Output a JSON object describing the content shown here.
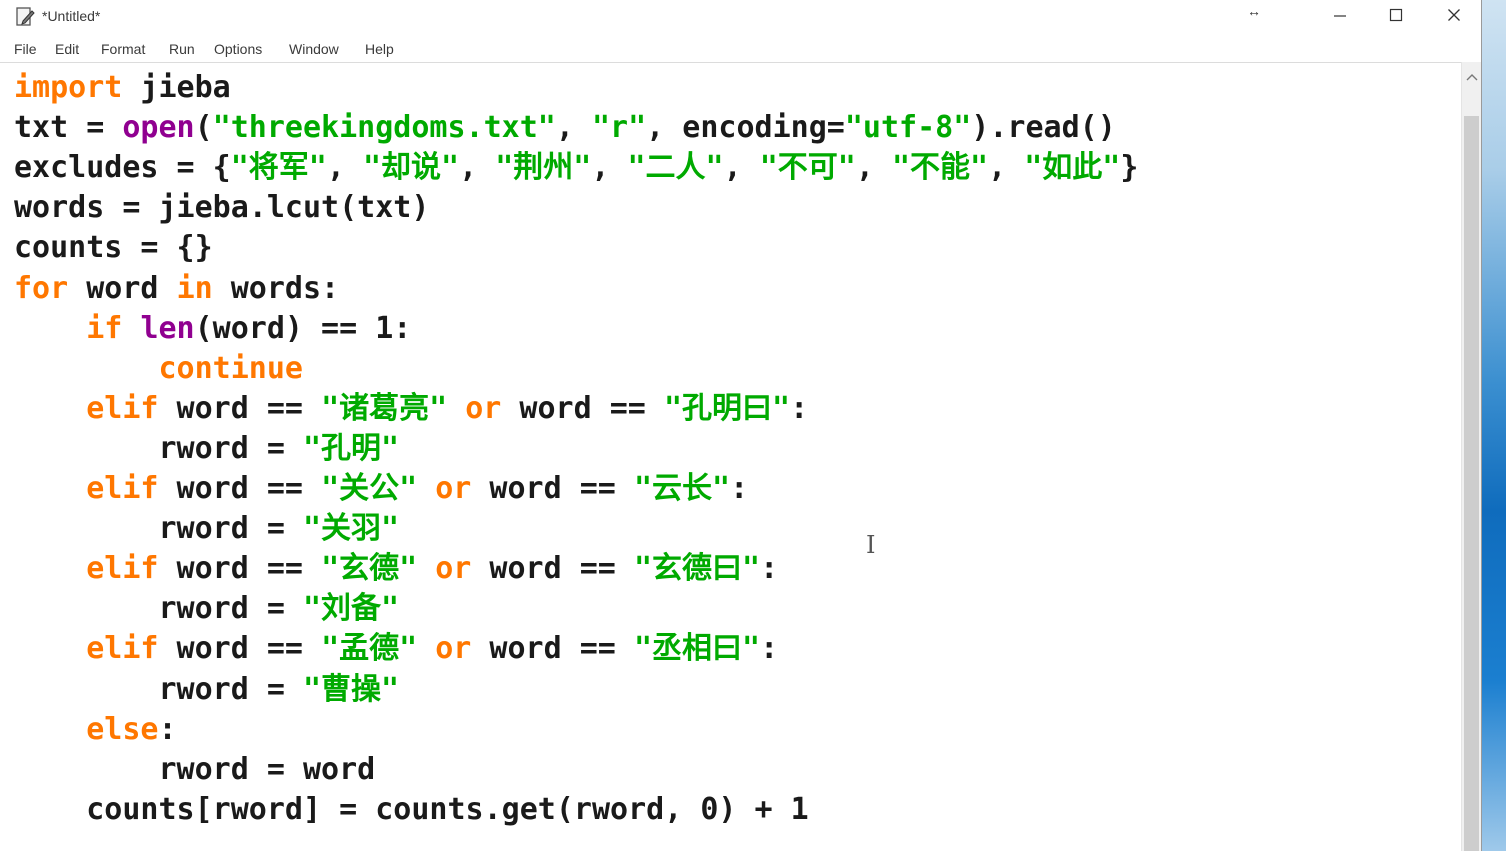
{
  "window": {
    "title": "*Untitled*",
    "resize_hint": "↔"
  },
  "menu": [
    "File",
    "Edit",
    "Format",
    "Run",
    "Options",
    "Window",
    "Help"
  ],
  "code_lines": [
    [
      [
        "kw",
        "import"
      ],
      [
        "n",
        " jieba"
      ]
    ],
    [
      [
        "n",
        "txt = "
      ],
      [
        "bi",
        "open"
      ],
      [
        "n",
        "("
      ],
      [
        "st",
        "\"threekingdoms.txt\""
      ],
      [
        "n",
        ", "
      ],
      [
        "st",
        "\"r\""
      ],
      [
        "n",
        ", encoding="
      ],
      [
        "st",
        "\"utf-8\""
      ],
      [
        "n",
        ").read()"
      ]
    ],
    [
      [
        "n",
        "excludes = {"
      ],
      [
        "st",
        "\"将军\""
      ],
      [
        "n",
        ", "
      ],
      [
        "st",
        "\"却说\""
      ],
      [
        "n",
        ", "
      ],
      [
        "st",
        "\"荆州\""
      ],
      [
        "n",
        ", "
      ],
      [
        "st",
        "\"二人\""
      ],
      [
        "n",
        ", "
      ],
      [
        "st",
        "\"不可\""
      ],
      [
        "n",
        ", "
      ],
      [
        "st",
        "\"不能\""
      ],
      [
        "n",
        ", "
      ],
      [
        "st",
        "\"如此\""
      ],
      [
        "n",
        "}"
      ]
    ],
    [
      [
        "n",
        "words = jieba.lcut(txt)"
      ]
    ],
    [
      [
        "n",
        "counts = {}"
      ]
    ],
    [
      [
        "kw",
        "for"
      ],
      [
        "n",
        " word "
      ],
      [
        "kw",
        "in"
      ],
      [
        "n",
        " words:"
      ]
    ],
    [
      [
        "n",
        "    "
      ],
      [
        "kw",
        "if"
      ],
      [
        "n",
        " "
      ],
      [
        "bi",
        "len"
      ],
      [
        "n",
        "(word) == 1:"
      ]
    ],
    [
      [
        "n",
        "        "
      ],
      [
        "kw",
        "continue"
      ]
    ],
    [
      [
        "n",
        "    "
      ],
      [
        "kw",
        "elif"
      ],
      [
        "n",
        " word == "
      ],
      [
        "st",
        "\"诸葛亮\""
      ],
      [
        "n",
        " "
      ],
      [
        "kw",
        "or"
      ],
      [
        "n",
        " word == "
      ],
      [
        "st",
        "\"孔明曰\""
      ],
      [
        "n",
        ":"
      ]
    ],
    [
      [
        "n",
        "        rword = "
      ],
      [
        "st",
        "\"孔明\""
      ]
    ],
    [
      [
        "n",
        "    "
      ],
      [
        "kw",
        "elif"
      ],
      [
        "n",
        " word == "
      ],
      [
        "st",
        "\"关公\""
      ],
      [
        "n",
        " "
      ],
      [
        "kw",
        "or"
      ],
      [
        "n",
        " word == "
      ],
      [
        "st",
        "\"云长\""
      ],
      [
        "n",
        ":"
      ]
    ],
    [
      [
        "n",
        "        rword = "
      ],
      [
        "st",
        "\"关羽\""
      ]
    ],
    [
      [
        "n",
        "    "
      ],
      [
        "kw",
        "elif"
      ],
      [
        "n",
        " word == "
      ],
      [
        "st",
        "\"玄德\""
      ],
      [
        "n",
        " "
      ],
      [
        "kw",
        "or"
      ],
      [
        "n",
        " word == "
      ],
      [
        "st",
        "\"玄德曰\""
      ],
      [
        "n",
        ":"
      ]
    ],
    [
      [
        "n",
        "        rword = "
      ],
      [
        "st",
        "\"刘备\""
      ]
    ],
    [
      [
        "n",
        "    "
      ],
      [
        "kw",
        "elif"
      ],
      [
        "n",
        " word == "
      ],
      [
        "st",
        "\"孟德\""
      ],
      [
        "n",
        " "
      ],
      [
        "kw",
        "or"
      ],
      [
        "n",
        " word == "
      ],
      [
        "st",
        "\"丞相曰\""
      ],
      [
        "n",
        ":"
      ]
    ],
    [
      [
        "n",
        "        rword = "
      ],
      [
        "st",
        "\"曹操\""
      ]
    ],
    [
      [
        "n",
        "    "
      ],
      [
        "kw",
        "else"
      ],
      [
        "n",
        ":"
      ]
    ],
    [
      [
        "n",
        "        rword = word"
      ]
    ],
    [
      [
        "n",
        "    counts[rword] = counts.get(rword, 0) + 1"
      ]
    ]
  ],
  "colors": {
    "keyword": "#ff7700",
    "builtin": "#900090",
    "string": "#00aa00",
    "default": "#1a1a1a"
  },
  "icons": {
    "app": "idle-file-icon",
    "minimize": "minimize-icon",
    "maximize": "maximize-icon",
    "close": "close-icon",
    "scroll_up": "chevron-up-icon",
    "text_cursor": "text-cursor-icon"
  }
}
